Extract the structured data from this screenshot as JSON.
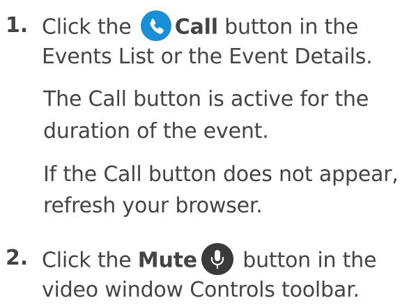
{
  "steps": [
    {
      "number": "1.",
      "line1": {
        "before": "Click the ",
        "icon": "phone-icon",
        "bold": "Call",
        "after": " button in the"
      },
      "line2": "Events List or the Event Details.",
      "notes": [
        {
          "line1": "The Call button is active for the",
          "line2": "duration of the event."
        },
        {
          "line1": "If the Call button does not appear,",
          "line2": "refresh your browser."
        }
      ]
    },
    {
      "number": "2.",
      "line1": {
        "before": "Click the ",
        "bold": "Mute",
        "icon": "microphone-icon",
        "after": " button in the"
      },
      "line2": "video window Controls toolbar."
    }
  ],
  "colors": {
    "text": "#444444",
    "call_icon_bg": "#1a8fd8",
    "mute_icon_bg": "#3a3a3a"
  }
}
